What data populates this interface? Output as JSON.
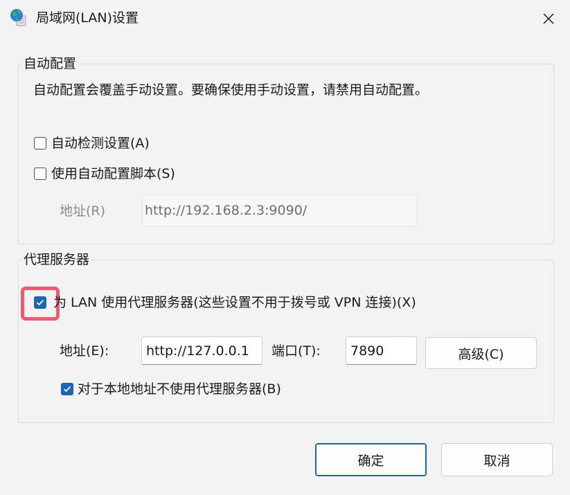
{
  "window": {
    "title": "局域网(LAN)设置",
    "close_glyph": "✕"
  },
  "auto_config": {
    "group_title": "自动配置",
    "description": "自动配置会覆盖手动设置。要确保使用手动设置，请禁用自动配置。",
    "auto_detect": {
      "label": "自动检测设置(A)",
      "checked": false
    },
    "use_script": {
      "label": "使用自动配置脚本(S)",
      "checked": false
    },
    "address_label": "地址(R)",
    "address_value": "http://192.168.2.3:9090/"
  },
  "proxy": {
    "group_title": "代理服务器",
    "use_proxy": {
      "label": "为 LAN 使用代理服务器(这些设置不用于拨号或 VPN 连接)(X)",
      "checked": true
    },
    "address_label": "地址(E):",
    "address_value": "http://127.0.0.1",
    "port_label": "端口(T):",
    "port_value": "7890",
    "advanced_label": "高级(C)",
    "bypass_local": {
      "label": "对于本地地址不使用代理服务器(B)",
      "checked": true
    }
  },
  "footer": {
    "ok_label": "确定",
    "cancel_label": "取消"
  },
  "colors": {
    "accent": "#1c64b4",
    "highlight": "#ef5a6f"
  },
  "icons": {
    "app": "globe-network-icon",
    "close": "close-icon",
    "check": "check-icon"
  }
}
